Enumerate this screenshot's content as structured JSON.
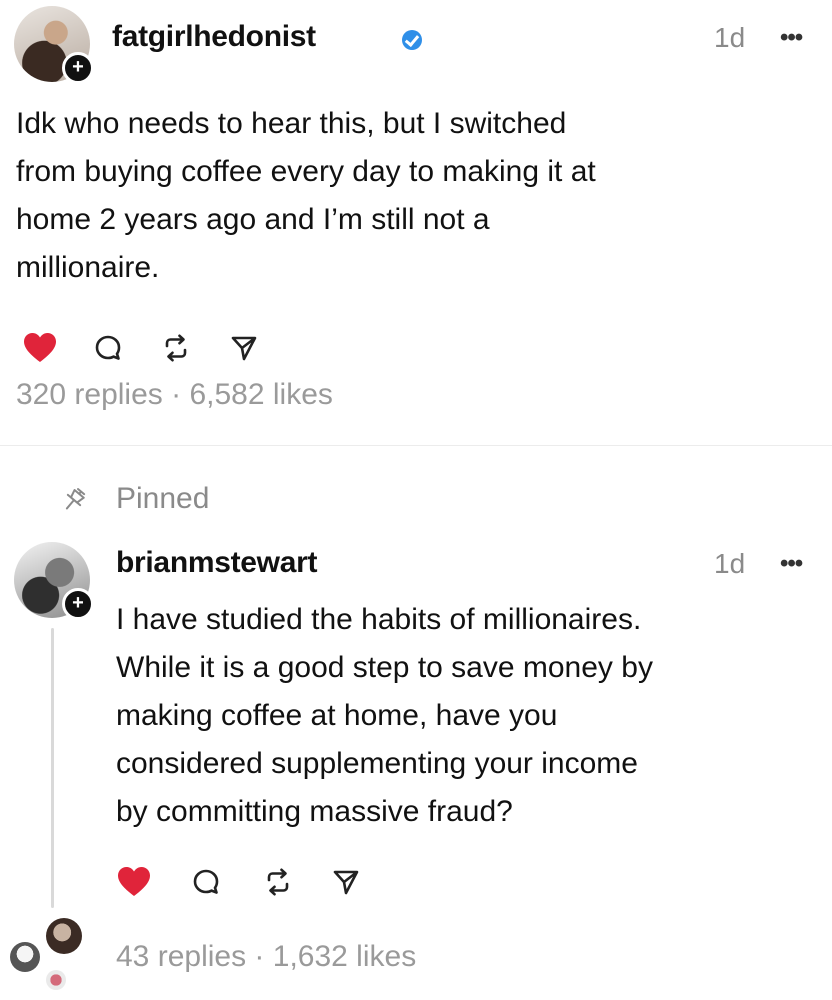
{
  "post": {
    "username": "fatgirlhedonist",
    "verified": true,
    "time": "1d",
    "more_label": "•••",
    "text": "Idk who needs to hear this, but I switched\nfrom buying coffee every day to making it at\nhome 2 years ago and I’m still not a\nmillionaire.",
    "liked": true,
    "replies": "320 replies",
    "separator": "·",
    "likes": "6,582 likes"
  },
  "pinned": {
    "label": "Pinned"
  },
  "reply": {
    "username": "brianmstewart",
    "time": "1d",
    "more_label": "•••",
    "text": "I have studied the habits of millionaires.\nWhile it is a good step to save money by\nmaking coffee at home, have you\nconsidered supplementing your income\nby committing massive fraud?",
    "liked": true,
    "replies": "43 replies",
    "separator": "·",
    "likes": "1,632 likes"
  },
  "colors": {
    "like_red": "#e0243a",
    "meta_gray": "#9a9a9a",
    "verified_blue": "#2f8fe8"
  },
  "icons": [
    "heart-icon",
    "comment-icon",
    "repost-icon",
    "share-icon",
    "pin-icon",
    "verified-icon",
    "plus-icon",
    "more-icon"
  ]
}
